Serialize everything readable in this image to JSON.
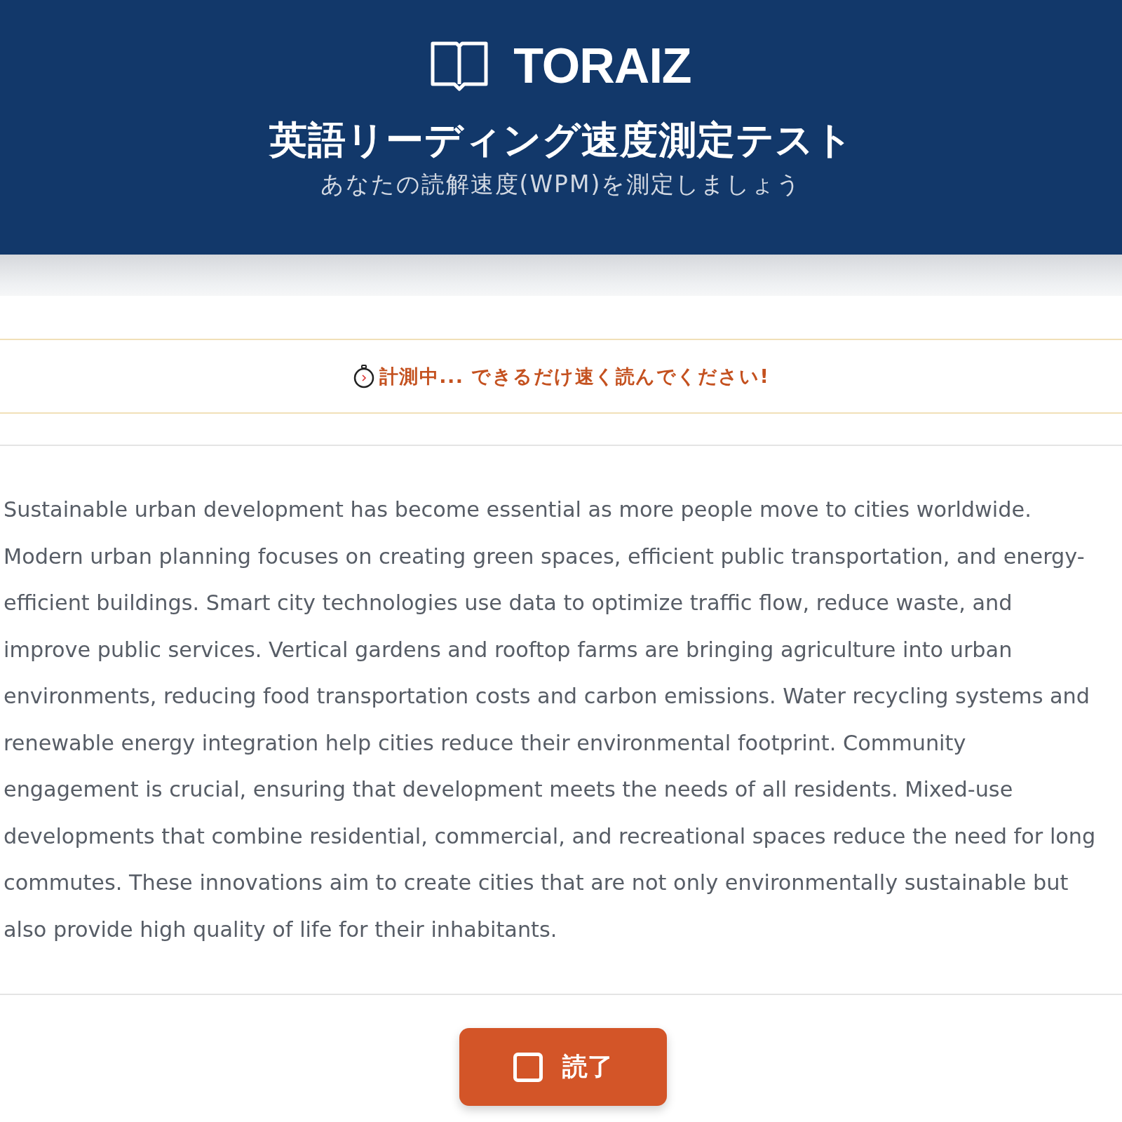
{
  "header": {
    "logo": {
      "text": "TORAIZ"
    },
    "title": "英語リーディング速度測定テスト",
    "subtitle": "あなたの読解速度(WPM)を測定しましょう"
  },
  "status_banner": {
    "text": "計測中... できるだけ速く読んでください!"
  },
  "passage": {
    "text": "Sustainable urban development has become essential as more people move to cities worldwide. Modern urban planning focuses on creating green spaces, efficient public transportation, and energy-efficient buildings. Smart city technologies use data to optimize traffic flow, reduce waste, and improve public services. Vertical gardens and rooftop farms are bringing agriculture into urban environments, reducing food transportation costs and carbon emissions. Water recycling systems and renewable energy integration help cities reduce their environmental footprint. Community engagement is crucial, ensuring that development meets the needs of all residents. Mixed-use developments that combine residential, commercial, and recreational spaces reduce the need for long commutes. These innovations aim to create cities that are not only environmentally sustainable but also provide high quality of life for their inhabitants."
  },
  "finish_button": {
    "label": "読了"
  }
}
